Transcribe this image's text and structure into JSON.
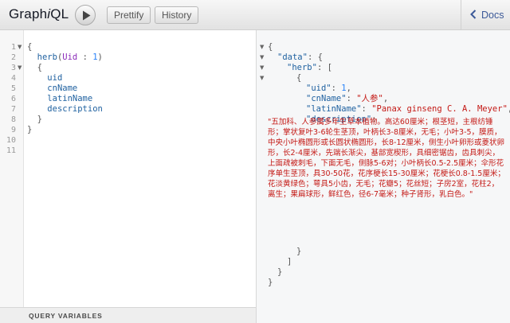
{
  "app": {
    "logo_pre": "Graph",
    "logo_i": "i",
    "logo_post": "QL",
    "prettify_label": "Prettify",
    "history_label": "History",
    "docs_label": "Docs"
  },
  "editor": {
    "line_numbers": [
      "1",
      "2",
      "3",
      "4",
      "5",
      "6",
      "7",
      "8",
      "9",
      "10",
      "11"
    ],
    "query": {
      "open_brace": "{",
      "field": "herb",
      "arg_open": "(",
      "arg_name": "Uid",
      "arg_colon": " : ",
      "arg_value": "1",
      "arg_close": ")",
      "sel_open": "{",
      "fields": [
        "uid",
        "cnName",
        "latinName",
        "description"
      ],
      "sel_close": "}",
      "close_brace": "}"
    },
    "variables_label": "QUERY VARIABLES"
  },
  "result": {
    "open_brace": "{",
    "data_key": "\"data\"",
    "data_sep": ": {",
    "herb_key": "\"herb\"",
    "herb_sep": ": [",
    "item_open": "{",
    "uid_key": "\"uid\"",
    "uid_value": "1",
    "cn_key": "\"cnName\"",
    "cn_value": "\"人参\"",
    "latin_key": "\"latinName\"",
    "latin_value": "\"Panax ginseng C. A. Meyer\"",
    "desc_key": "\"description\"",
    "desc_value": "\"五加科、人参属多年生草本植物。高达60厘米；根茎短，主根纺锤形；掌状复叶3-6轮生茎顶，叶柄长3-8厘米，无毛；小叶3-5，膜质，中央小叶椭圆形或长圆状椭圆形，长8-12厘米，侧生小叶卵形或菱状卵形，长2-4厘米，先端长渐尖，基部宽楔形，具细密锯齿，齿具刺尖，上面疏被刺毛，下面无毛，侧脉5-6对；小叶柄长0.5-2.5厘米；伞形花序单生茎顶，具30-50花，花序梗长15-30厘米；花梗长0.8-1.5厘米；花淡黄绿色；萼具5小齿，无毛；花瓣5；花丝短；子房2室，花柱2，离生；果扁球形，鲜红色，径6-7毫米；种子肾形，乳白色。\"",
    "item_close": "}",
    "array_close": "]",
    "data_close": "}",
    "close_brace": "}"
  }
}
